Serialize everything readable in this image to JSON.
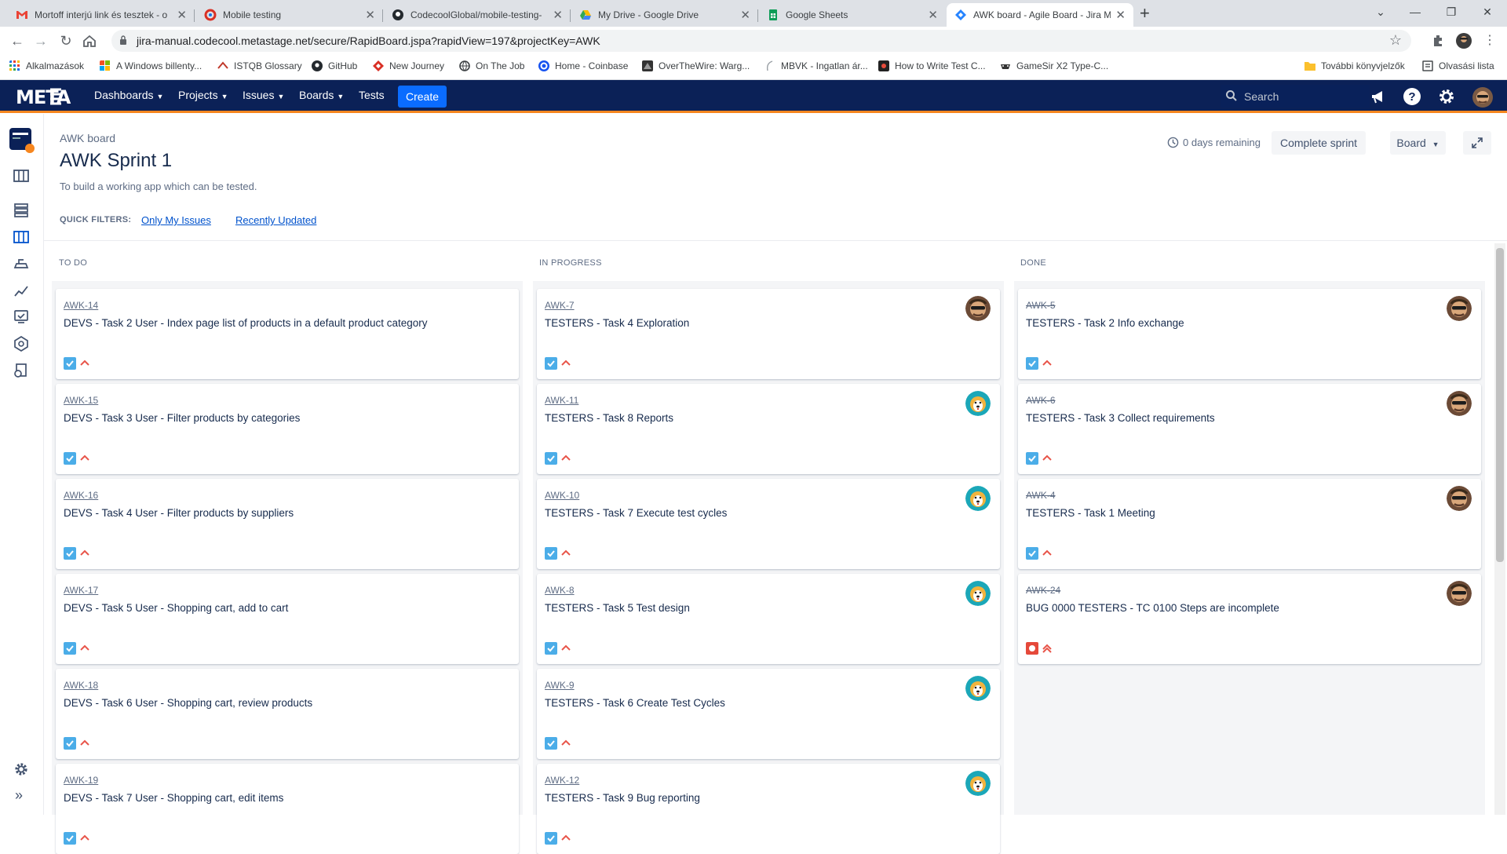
{
  "browser": {
    "tabs": [
      {
        "title": "Mortoff interjú link és tesztek - o",
        "icon": "gmail-icon"
      },
      {
        "title": "Mobile testing",
        "icon": "codecool-icon"
      },
      {
        "title": "CodecoolGlobal/mobile-testing-",
        "icon": "github-icon"
      },
      {
        "title": "My Drive - Google Drive",
        "icon": "google-drive-icon"
      },
      {
        "title": "Google Sheets",
        "icon": "google-sheets-icon"
      },
      {
        "title": "AWK board - Agile Board - Jira M",
        "icon": "jira-icon",
        "active": true
      }
    ],
    "url": "jira-manual.codecool.metastage.net/secure/RapidBoard.jspa?rapidView=197&projectKey=AWK",
    "bookmarks": [
      {
        "label": "Alkalmazások",
        "icon": "apps-grid-icon"
      },
      {
        "label": "A Windows billenty...",
        "icon": "windows-icon"
      },
      {
        "label": "ISTQB Glossary",
        "icon": "istqb-icon"
      },
      {
        "label": "GitHub",
        "icon": "github-icon"
      },
      {
        "label": "New Journey",
        "icon": "diamond-icon"
      },
      {
        "label": "On The Job",
        "icon": "globe-icon"
      },
      {
        "label": "Home - Coinbase",
        "icon": "coinbase-icon"
      },
      {
        "label": "OverTheWire: Warg...",
        "icon": "overthewire-icon"
      },
      {
        "label": "MBVK - Ingatlan ár...",
        "icon": "feather-icon"
      },
      {
        "label": "How to Write Test C...",
        "icon": "site-icon"
      },
      {
        "label": "GameSir X2 Type-C...",
        "icon": "gamesir-icon"
      },
      {
        "label": "További könyvjelzők",
        "icon": "folder-icon"
      },
      {
        "label": "Olvasási lista",
        "icon": "reading-list-icon"
      }
    ]
  },
  "jira": {
    "logo": "META",
    "nav": [
      "Dashboards",
      "Projects",
      "Issues",
      "Boards",
      "Tests"
    ],
    "create_label": "Create",
    "search_placeholder": "Search"
  },
  "page": {
    "breadcrumb": "AWK board",
    "title": "AWK Sprint 1",
    "goal": "To build a working app which can be tested.",
    "quick_filters_label": "QUICK FILTERS:",
    "quick_filters": [
      "Only My Issues",
      "Recently Updated"
    ],
    "remaining": "0 days remaining",
    "complete_sprint": "Complete sprint",
    "board_menu": "Board"
  },
  "board": {
    "columns": [
      {
        "name": "TO DO",
        "cards": [
          {
            "key": "AWK-14",
            "summary": "DEVS - Task 2 User - Index page list of products in a default product category",
            "type": "task",
            "avatar": "none"
          },
          {
            "key": "AWK-15",
            "summary": "DEVS - Task 3 User - Filter products by categories",
            "type": "task",
            "avatar": "none"
          },
          {
            "key": "AWK-16",
            "summary": "DEVS - Task 4 User - Filter products by suppliers",
            "type": "task",
            "avatar": "none"
          },
          {
            "key": "AWK-17",
            "summary": "DEVS - Task 5 User - Shopping cart, add to cart",
            "type": "task",
            "avatar": "none"
          },
          {
            "key": "AWK-18",
            "summary": "DEVS - Task 6 User - Shopping cart, review products",
            "type": "task",
            "avatar": "none"
          },
          {
            "key": "AWK-19",
            "summary": "DEVS - Task 7 User - Shopping cart, edit items",
            "type": "task",
            "avatar": "none"
          }
        ]
      },
      {
        "name": "IN PROGRESS",
        "cards": [
          {
            "key": "AWK-7",
            "summary": "TESTERS - Task 4 Exploration",
            "type": "task",
            "avatar": "person"
          },
          {
            "key": "AWK-11",
            "summary": "TESTERS - Task 8 Reports",
            "type": "task",
            "avatar": "dog"
          },
          {
            "key": "AWK-10",
            "summary": "TESTERS - Task 7 Execute test cycles",
            "type": "task",
            "avatar": "dog"
          },
          {
            "key": "AWK-8",
            "summary": "TESTERS - Task 5 Test design",
            "type": "task",
            "avatar": "dog"
          },
          {
            "key": "AWK-9",
            "summary": "TESTERS - Task 6 Create Test Cycles",
            "type": "task",
            "avatar": "dog"
          },
          {
            "key": "AWK-12",
            "summary": "TESTERS - Task 9 Bug reporting",
            "type": "task",
            "avatar": "dog"
          }
        ]
      },
      {
        "name": "DONE",
        "cards": [
          {
            "key": "AWK-5",
            "summary": "TESTERS - Task 2 Info exchange",
            "type": "task",
            "avatar": "person"
          },
          {
            "key": "AWK-6",
            "summary": "TESTERS - Task 3 Collect requirements",
            "type": "task",
            "avatar": "person"
          },
          {
            "key": "AWK-4",
            "summary": "TESTERS - Task 1 Meeting",
            "type": "task",
            "avatar": "person"
          },
          {
            "key": "AWK-24",
            "summary": "BUG 0000 TESTERS - TC 0100 Steps are incomplete",
            "type": "bug",
            "avatar": "person"
          }
        ]
      }
    ]
  },
  "colors": {
    "header_bg": "#0b2157",
    "header_accent": "#f6861f",
    "create_button": "#0a6cff",
    "link": "#0052cc",
    "column_bg": "#f4f5f7"
  }
}
